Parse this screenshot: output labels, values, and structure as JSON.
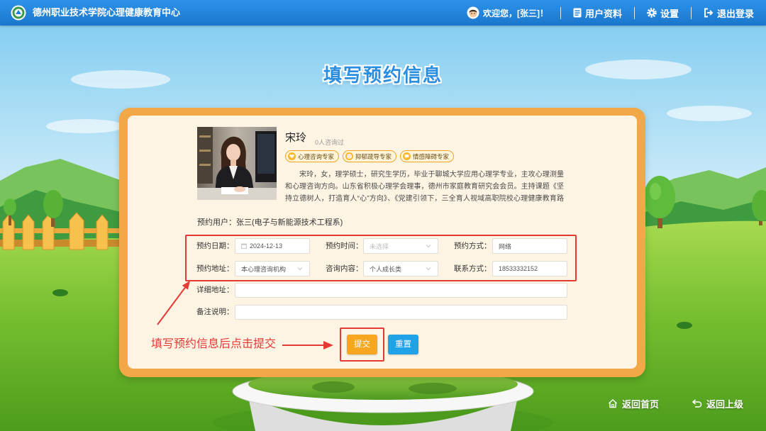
{
  "header": {
    "site_title": "德州职业技术学院心理健康教育中心",
    "welcome": "欢迎您，[张三]！",
    "profile": "用户资料",
    "settings": "设置",
    "logout": "退出登录",
    "icons": {
      "logo": "school-logo",
      "user": "avatar-icon",
      "profile": "document-icon",
      "settings": "gear-icon",
      "logout": "logout-icon"
    }
  },
  "page_title": "填写预约信息",
  "counselor": {
    "name": "宋玲",
    "consult_count": "0人咨询过",
    "tags": [
      {
        "label": "心理咨询专家",
        "icon": "heart-icon"
      },
      {
        "label": "抑郁疏导专家",
        "icon": "smile-icon"
      },
      {
        "label": "情感障碍专家",
        "icon": "chat-icon"
      }
    ],
    "bio": "宋玲，女，理学硕士，研究生学历，毕业于聊城大学应用心理学专业，主攻心理测量和心理咨询方向。山东省积极心理学会理事，德州市家庭教育研究会会员。主持课题《坚持立德树人，打造育人“心”方向》、《党建引领下，三全育人视域高职院校心理健康教育路径"
  },
  "appointment": {
    "user_label": "预约用户：",
    "user_value": "张三(电子与新能源技术工程系)",
    "date": {
      "label": "预约日期：",
      "value": "2024-12-13"
    },
    "time": {
      "label": "预约时间：",
      "placeholder": "未选择"
    },
    "method": {
      "label": "预约方式：",
      "value": "网络"
    },
    "location": {
      "label": "预约地址：",
      "value": "本心理咨询机构"
    },
    "topic": {
      "label": "咨询内容：",
      "value": "个人成长类"
    },
    "contact": {
      "label": "联系方式：",
      "value": "18533332152"
    },
    "detail_address": {
      "label": "详细地址："
    },
    "remark": {
      "label": "备注说明："
    }
  },
  "buttons": {
    "submit": "提交",
    "reset": "重置"
  },
  "annotation": "填写预约信息后点击提交",
  "footer_nav": {
    "home": "返回首页",
    "back": "返回上级",
    "home_icon": "home-icon",
    "back_icon": "back-arrow-icon"
  },
  "colors": {
    "header_bg": "#1f80d8",
    "title": "#2a8ee0",
    "card_border": "#f2a846",
    "card_bg": "#fdf4e4",
    "submit": "#f8a51f",
    "reset": "#1fa2e8",
    "annotation_red": "#e53935"
  }
}
